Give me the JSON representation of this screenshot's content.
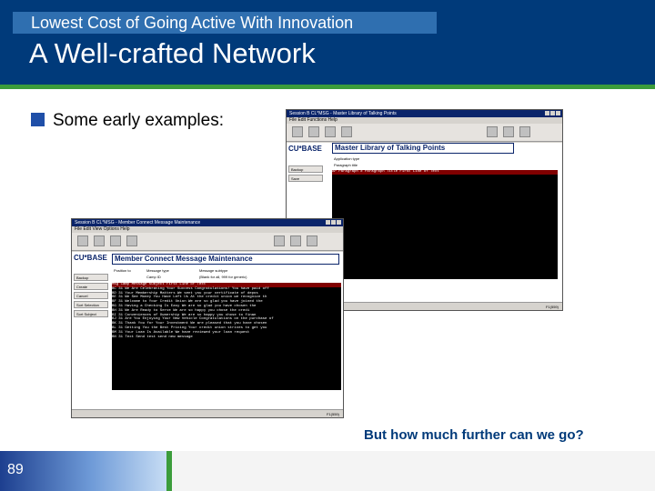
{
  "slide": {
    "subtitle": "Lowest Cost of Going Active With Innovation",
    "title": "A Well-crafted Network",
    "bullet": "Some early examples:",
    "question": "But how much further can we go?",
    "page_number": "89",
    "colors": {
      "header": "#003a7a",
      "subtitle_bar": "#2f6fb0",
      "accent_rule": "#3b9c3b",
      "bullet": "#1f4fa8"
    }
  },
  "window_back": {
    "title": "Session B CL*MSG - Master Library of Talking Points",
    "menu": "File Edit Functions Help",
    "panel_title": "Master Library of Talking Points",
    "label_app_type": "Application type",
    "label_para_title": "Paragraph title",
    "side_buttons": [
      "Backup",
      "Save"
    ],
    "grid_header": "AP  Paragraph #   Paragraph Title   First Line of Text",
    "status": "F1(559)"
  },
  "window_front": {
    "title": "Session B CL*MSG - Member Connect Message Maintenance",
    "menu": "File Edit View Options Help",
    "logo": "CU*BASE",
    "panel_title": "Member Connect Message Maintenance",
    "label_position": "Position to",
    "label_message_type": "Message type",
    "label_message_subtype": "Message subtype",
    "label_camp": "Camp ID",
    "hint": "(Blank for all, 999 for generic)",
    "side_buttons": [
      "Backup",
      "Create",
      "Cancel",
      "Sort Selection",
      "Sort Subject"
    ],
    "grid_header": "Msg Camp  Message Subject                 First Line of Text",
    "rows": [
      "BC  31   We Are Celebrating Your Success    Congratulations! You have paid off",
      "BD  31   Your Membership Matters            We sent you your certificate of depos",
      "BE  31   We See Money You Have Left Us      At the credit union we recognize th",
      "BF  31   Welcome to Your Credit Union       We are so glad you have joined the",
      "BG  31   Having a Checking Is Easy          We are so glad you have chosen the",
      "BH  31   We Are Ready to Serve              We are so happy you chose the credi",
      "BI  31   Conveniences of Ownership          We are so happy you chose to finan",
      "BJ  31   Are You Enjoying Your New Vehicle  Congratulations on the purchase of",
      "BK  31   Thank You for Your Investment      We are pleased that you have chosen",
      "BL  31   Getting You the Best Pricing       Your credit union strives to get you",
      "BM  31   Your Loan Is Available             We have reviewed your loan request",
      "BN  31   Text Send                          test send new message"
    ],
    "status": "F1(559)"
  }
}
